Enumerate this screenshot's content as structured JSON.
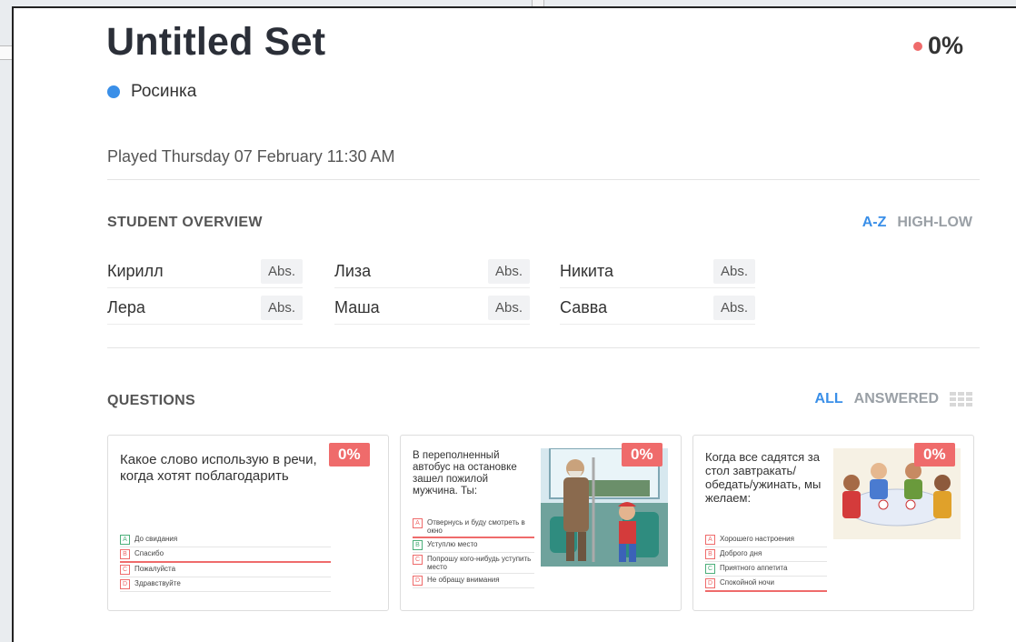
{
  "set": {
    "title": "Untitled Set",
    "score": "0%",
    "class_name": "Росинка",
    "played": "Played Thursday 07 February 11:30 AM"
  },
  "student_overview": {
    "heading": "STUDENT OVERVIEW",
    "sort_az": "A-Z",
    "sort_highlow": "HIGH-LOW",
    "students": [
      {
        "name": "Кирилл",
        "status": "Abs."
      },
      {
        "name": "Лиза",
        "status": "Abs."
      },
      {
        "name": "Никита",
        "status": "Abs."
      },
      {
        "name": "Лера",
        "status": "Abs."
      },
      {
        "name": "Маша",
        "status": "Abs."
      },
      {
        "name": "Савва",
        "status": "Abs."
      }
    ]
  },
  "questions": {
    "heading": "QUESTIONS",
    "filter_all": "ALL",
    "filter_answered": "ANSWERED",
    "cards": [
      {
        "text": "Какое слово использую в речи, когда хотят поблагодарить",
        "score": "0%",
        "answers": [
          {
            "letter": "A",
            "text": "До свидания"
          },
          {
            "letter": "B",
            "text": "Спасибо"
          },
          {
            "letter": "C",
            "text": "Пожалуйста"
          },
          {
            "letter": "D",
            "text": "Здравствуйте"
          }
        ]
      },
      {
        "text": "В переполненный автобус на остановке зашел пожилой мужчина. Ты:",
        "score": "0%",
        "answers": [
          {
            "letter": "A",
            "text": "Отвернусь и буду смотреть в окно"
          },
          {
            "letter": "B",
            "text": "Уступлю место"
          },
          {
            "letter": "C",
            "text": "Попрошу кого-нибудь уступить место"
          },
          {
            "letter": "D",
            "text": "Не обращу внимания"
          }
        ]
      },
      {
        "text": "Когда все садятся за стол завтракать/обедать/ужинать, мы желаем:",
        "score": "0%",
        "answers": [
          {
            "letter": "A",
            "text": "Хорошего настроения"
          },
          {
            "letter": "B",
            "text": "Доброго дня"
          },
          {
            "letter": "C",
            "text": "Приятного аппетита"
          },
          {
            "letter": "D",
            "text": "Спокойной ночи"
          }
        ]
      }
    ]
  },
  "colors": {
    "accent": "#3a8fe8",
    "danger": "#ef6b6b",
    "correct": "#4caf7a"
  }
}
